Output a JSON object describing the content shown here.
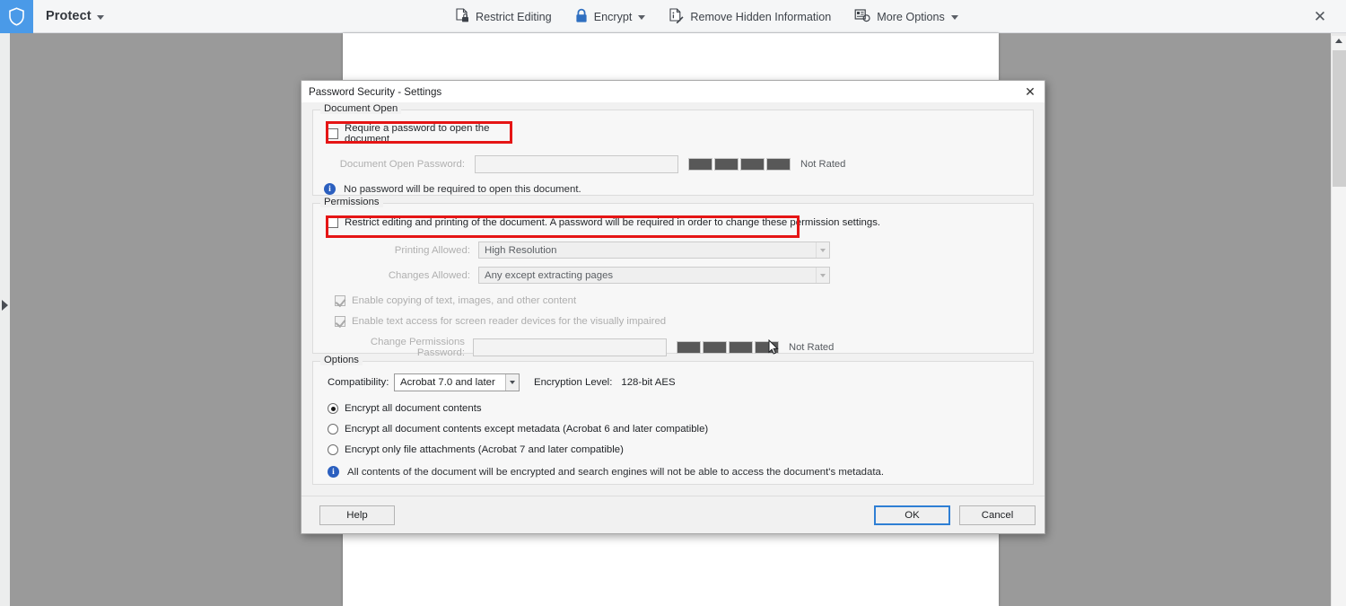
{
  "toolbar": {
    "brand_icon": "shield-icon",
    "brand_color": "#4a9ae8",
    "tab_label": "Protect",
    "items": [
      {
        "icon": "restrict-editing-icon",
        "label": "Restrict Editing",
        "has_caret": false
      },
      {
        "icon": "lock-icon",
        "label": "Encrypt",
        "has_caret": true
      },
      {
        "icon": "remove-hidden-information-icon",
        "label": "Remove Hidden Information",
        "has_caret": false
      },
      {
        "icon": "more-options-icon",
        "label": "More Options",
        "has_caret": true
      }
    ],
    "close_label": "✕"
  },
  "dialog": {
    "title": "Password Security - Settings",
    "close_label": "✕",
    "document_open": {
      "legend": "Document Open",
      "require_password_checkbox": {
        "label": "Require a password to open the document",
        "checked": false,
        "highlighted": true
      },
      "password_label": "Document Open Password:",
      "password_value": "",
      "strength_segments": 4,
      "strength_text": "Not Rated",
      "info_text": "No password will be required to open this document."
    },
    "permissions": {
      "legend": "Permissions",
      "restrict_checkbox": {
        "label": "Restrict editing and printing of the document. A password will be required in order to change these permission settings.",
        "checked": false,
        "highlighted": true
      },
      "printing_allowed_label": "Printing Allowed:",
      "printing_allowed_value": "High Resolution",
      "changes_allowed_label": "Changes Allowed:",
      "changes_allowed_value": "Any except extracting pages",
      "enable_copying": {
        "label": "Enable copying of text, images, and other content",
        "checked": true
      },
      "enable_screen_reader": {
        "label": "Enable text access for screen reader devices for the visually impaired",
        "checked": true
      },
      "change_permissions_password_label": "Change Permissions Password:",
      "change_permissions_password_value": "",
      "strength_segments": 4,
      "strength_text": "Not Rated"
    },
    "options": {
      "legend": "Options",
      "compatibility_label": "Compatibility:",
      "compatibility_value": "Acrobat 7.0 and later",
      "encryption_level_label": "Encryption  Level:",
      "encryption_level_value": "128-bit AES",
      "radios": [
        {
          "label": "Encrypt all document contents",
          "selected": true
        },
        {
          "label": "Encrypt all document contents except metadata (Acrobat 6 and later compatible)",
          "selected": false
        },
        {
          "label": "Encrypt only file attachments (Acrobat 7 and later compatible)",
          "selected": false
        }
      ],
      "info_text": "All contents of the document will be encrypted and search engines will not be able to access the document's metadata."
    },
    "footer": {
      "help_label": "Help",
      "ok_label": "OK",
      "cancel_label": "Cancel"
    }
  },
  "canvas": {
    "left_rail_icon": "expand-panel-arrow-icon",
    "scrollbar_up_icon": "scroll-up-arrow-icon"
  },
  "colors": {
    "accent": "#4a9ae8",
    "highlight": "#e51515",
    "info": "#2b5fbf",
    "focus_border": "#2f7fd4"
  }
}
